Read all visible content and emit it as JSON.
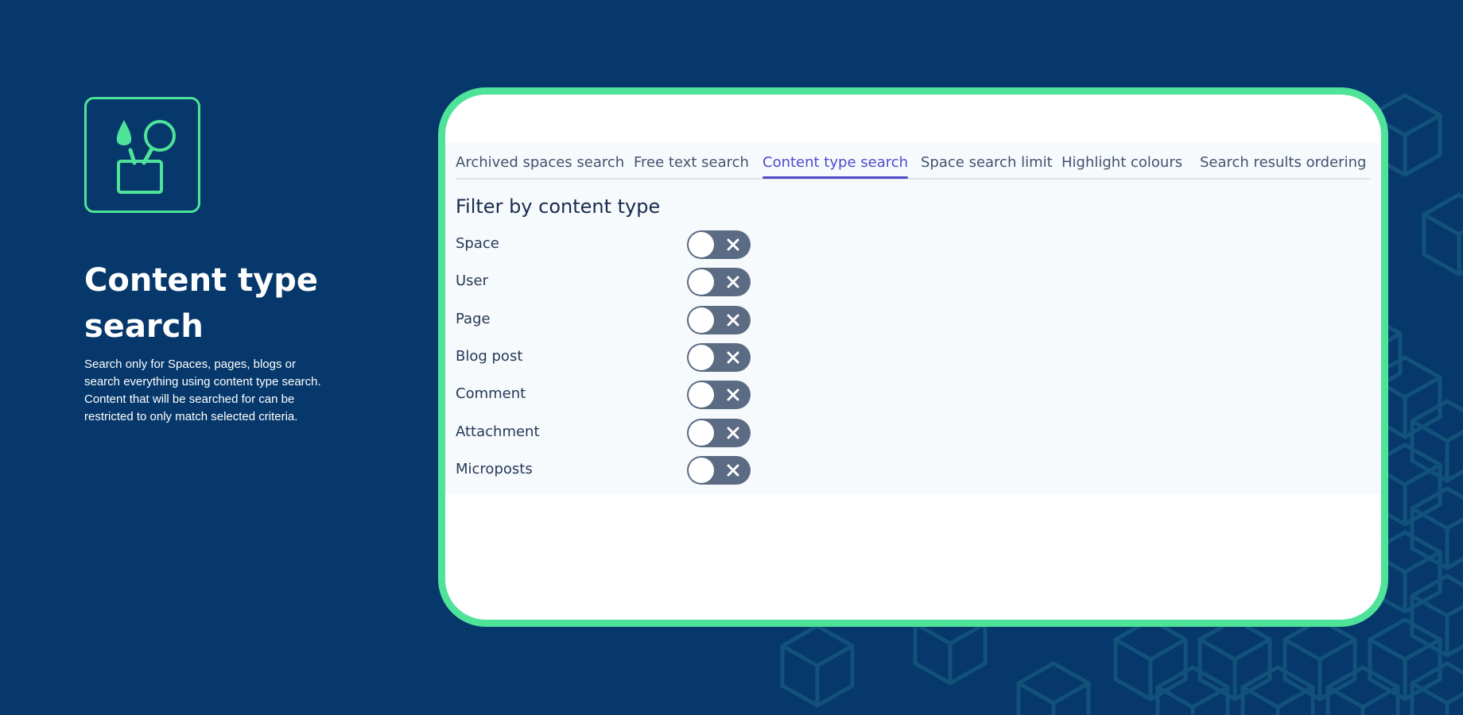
{
  "feature": {
    "icon": "paintbrush-magnifier-cup-icon",
    "title_line1": "Content type",
    "title_line2": "search",
    "description": "Search only for Spaces, pages, blogs or search everything using content type search. Content that will be searched for can be restricted to only match selected criteria."
  },
  "colors": {
    "background": "#06386b",
    "accent_green": "#4fe39a",
    "active_tab": "#4c4cc9",
    "toggle_off": "#5b6b83"
  },
  "app": {
    "tabs": [
      {
        "label": "Archived spaces search",
        "active": false
      },
      {
        "label": "Free text search",
        "active": false
      },
      {
        "label": "Content type search",
        "active": true
      },
      {
        "label": "Space search limit",
        "active": false
      },
      {
        "label": "Highlight colours",
        "active": false
      },
      {
        "label": "Search results ordering",
        "active": false
      }
    ],
    "section_heading": "Filter by content type",
    "filters": [
      {
        "label": "Space",
        "enabled": false
      },
      {
        "label": "User",
        "enabled": false
      },
      {
        "label": "Page",
        "enabled": false
      },
      {
        "label": "Blog post",
        "enabled": false
      },
      {
        "label": "Comment",
        "enabled": false
      },
      {
        "label": "Attachment",
        "enabled": false
      },
      {
        "label": "Microposts",
        "enabled": false
      }
    ]
  }
}
